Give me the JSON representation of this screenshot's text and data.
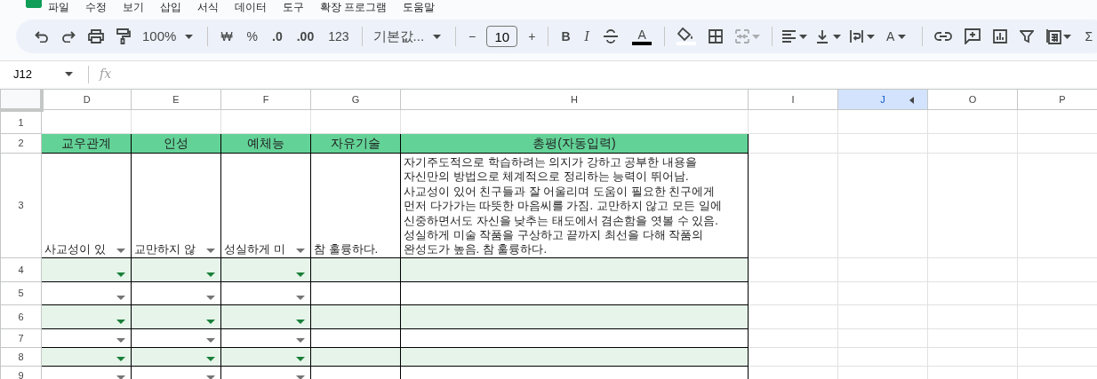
{
  "menu": [
    "파일",
    "수정",
    "보기",
    "삽입",
    "서식",
    "데이터",
    "도구",
    "확장 프로그램",
    "도움말"
  ],
  "toolbar": {
    "zoom": "100%",
    "currency": "₩",
    "percent": "%",
    "decimal_less": ".0",
    "decimal_more": ".00",
    "number_format": "123",
    "font": "기본값...",
    "font_size_minus": "−",
    "font_size": "10",
    "font_size_plus": "+",
    "bold": "B",
    "italic": "I",
    "text_color": "A",
    "text_rotation": "A",
    "sum": "Σ",
    "merge_disabled": true
  },
  "name_box": "J12",
  "formula_label": "fx",
  "columns": [
    {
      "letter": "D",
      "selected": false,
      "hidden_columns_after": false
    },
    {
      "letter": "E",
      "selected": false,
      "hidden_columns_after": false
    },
    {
      "letter": "F",
      "selected": false,
      "hidden_columns_after": false
    },
    {
      "letter": "G",
      "selected": false,
      "hidden_columns_after": false
    },
    {
      "letter": "H",
      "selected": false,
      "hidden_columns_after": false
    },
    {
      "letter": "I",
      "selected": false,
      "hidden_columns_after": false
    },
    {
      "letter": "J",
      "selected": true,
      "hidden_columns_after": true
    },
    {
      "letter": "O",
      "selected": false,
      "hidden_columns_after": false
    },
    {
      "letter": "P",
      "selected": false,
      "hidden_columns_after": false
    }
  ],
  "rows": [
    {
      "number": "1",
      "kind": "blank",
      "cells": []
    },
    {
      "number": "2",
      "kind": "header",
      "cells": [
        {
          "text": "교우관계"
        },
        {
          "text": "인성"
        },
        {
          "text": "예체능"
        },
        {
          "text": "자유기술"
        },
        {
          "text": "총평(자동입력)"
        }
      ]
    },
    {
      "number": "3",
      "kind": "data",
      "banded": false,
      "cells": [
        {
          "text": "사교성이 있",
          "dropdown": true
        },
        {
          "text": "교만하지 않",
          "dropdown": true
        },
        {
          "text": "성실하게 미",
          "dropdown": true
        },
        {
          "text": "참 훌륭하다.",
          "dropdown": false
        },
        {
          "text": "자기주도적으로 학습하려는 의지가 강하고 공부한 내용을\n자신만의 방법으로 체계적으로 정리하는 능력이 뛰어남.\n사교성이 있어 친구들과 잘 어울리며 도움이 필요한 친구에게\n먼저 다가가는 따뜻한 마음씨를 가짐. 교만하지 않고 모든 일에\n신중하면서도 자신을 낮추는 태도에서 겸손함을 엿볼 수 있음.\n성실하게 미술 작품을 구상하고 끝까지 최선을 다해 작품의\n완성도가 높음. 참 훌륭하다.",
          "dropdown": false
        }
      ]
    },
    {
      "number": "4",
      "kind": "data",
      "banded": true,
      "cells": [
        {
          "dropdown": true
        },
        {
          "dropdown": true
        },
        {
          "dropdown": true
        },
        {
          "dropdown": false
        },
        {
          "dropdown": false
        }
      ]
    },
    {
      "number": "5",
      "kind": "data",
      "banded": false,
      "cells": [
        {
          "dropdown": true
        },
        {
          "dropdown": true
        },
        {
          "dropdown": true
        },
        {
          "dropdown": false
        },
        {
          "dropdown": false
        }
      ]
    },
    {
      "number": "6",
      "kind": "data",
      "banded": true,
      "cells": [
        {
          "dropdown": true
        },
        {
          "dropdown": true
        },
        {
          "dropdown": true
        },
        {
          "dropdown": false
        },
        {
          "dropdown": false
        }
      ]
    },
    {
      "number": "7",
      "kind": "data",
      "banded": false,
      "cells": [
        {
          "dropdown": true
        },
        {
          "dropdown": true
        },
        {
          "dropdown": true
        },
        {
          "dropdown": false
        },
        {
          "dropdown": false
        }
      ]
    },
    {
      "number": "8",
      "kind": "data",
      "banded": true,
      "cells": [
        {
          "dropdown": true
        },
        {
          "dropdown": true
        },
        {
          "dropdown": true
        },
        {
          "dropdown": false
        },
        {
          "dropdown": false
        }
      ]
    },
    {
      "number": "9",
      "kind": "data",
      "banded": false,
      "cells": [
        {
          "dropdown": true
        },
        {
          "dropdown": true
        },
        {
          "dropdown": true
        },
        {
          "dropdown": false
        },
        {
          "dropdown": false
        }
      ]
    }
  ]
}
